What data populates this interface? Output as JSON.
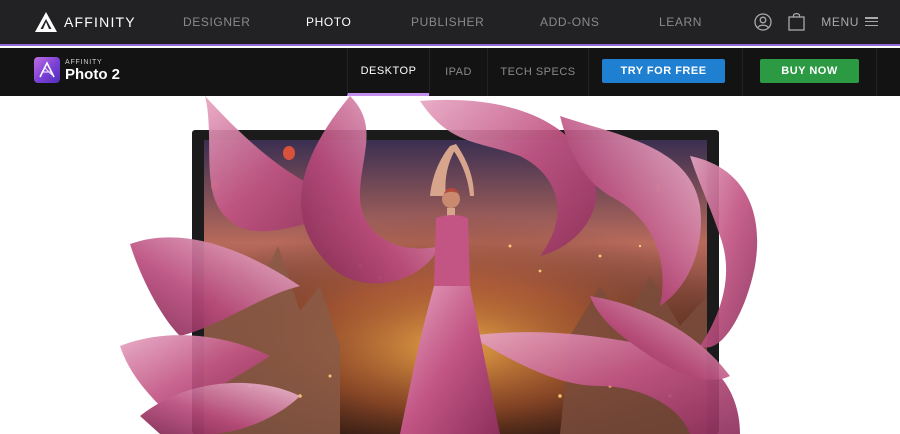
{
  "brand": {
    "name": "AFFINITY",
    "icon": "affinity-logo-icon"
  },
  "nav": {
    "items": [
      {
        "label": "DESIGNER",
        "active": false
      },
      {
        "label": "PHOTO",
        "active": true
      },
      {
        "label": "PUBLISHER",
        "active": false
      },
      {
        "label": "ADD-ONS",
        "active": false
      },
      {
        "label": "LEARN",
        "active": false
      }
    ],
    "menu_label": "MENU",
    "icons": [
      "account-icon",
      "cart-icon",
      "hamburger-icon"
    ]
  },
  "product": {
    "small_label": "AFFINITY",
    "name": "Photo 2",
    "icon": "affinity-photo-icon",
    "tabs": [
      {
        "label": "DESKTOP",
        "active": true
      },
      {
        "label": "IPAD",
        "active": false
      },
      {
        "label": "TECH SPECS",
        "active": false
      }
    ],
    "try_label": "TRY FOR FREE",
    "buy_label": "BUY NOW"
  },
  "colors": {
    "nav_bg": "#222224",
    "product_bar_bg": "#131314",
    "accent_purple": "#8e6bd8",
    "try_blue": "#1f7fd1",
    "buy_green": "#2b9a42",
    "fabric_pink": "#c25584"
  }
}
